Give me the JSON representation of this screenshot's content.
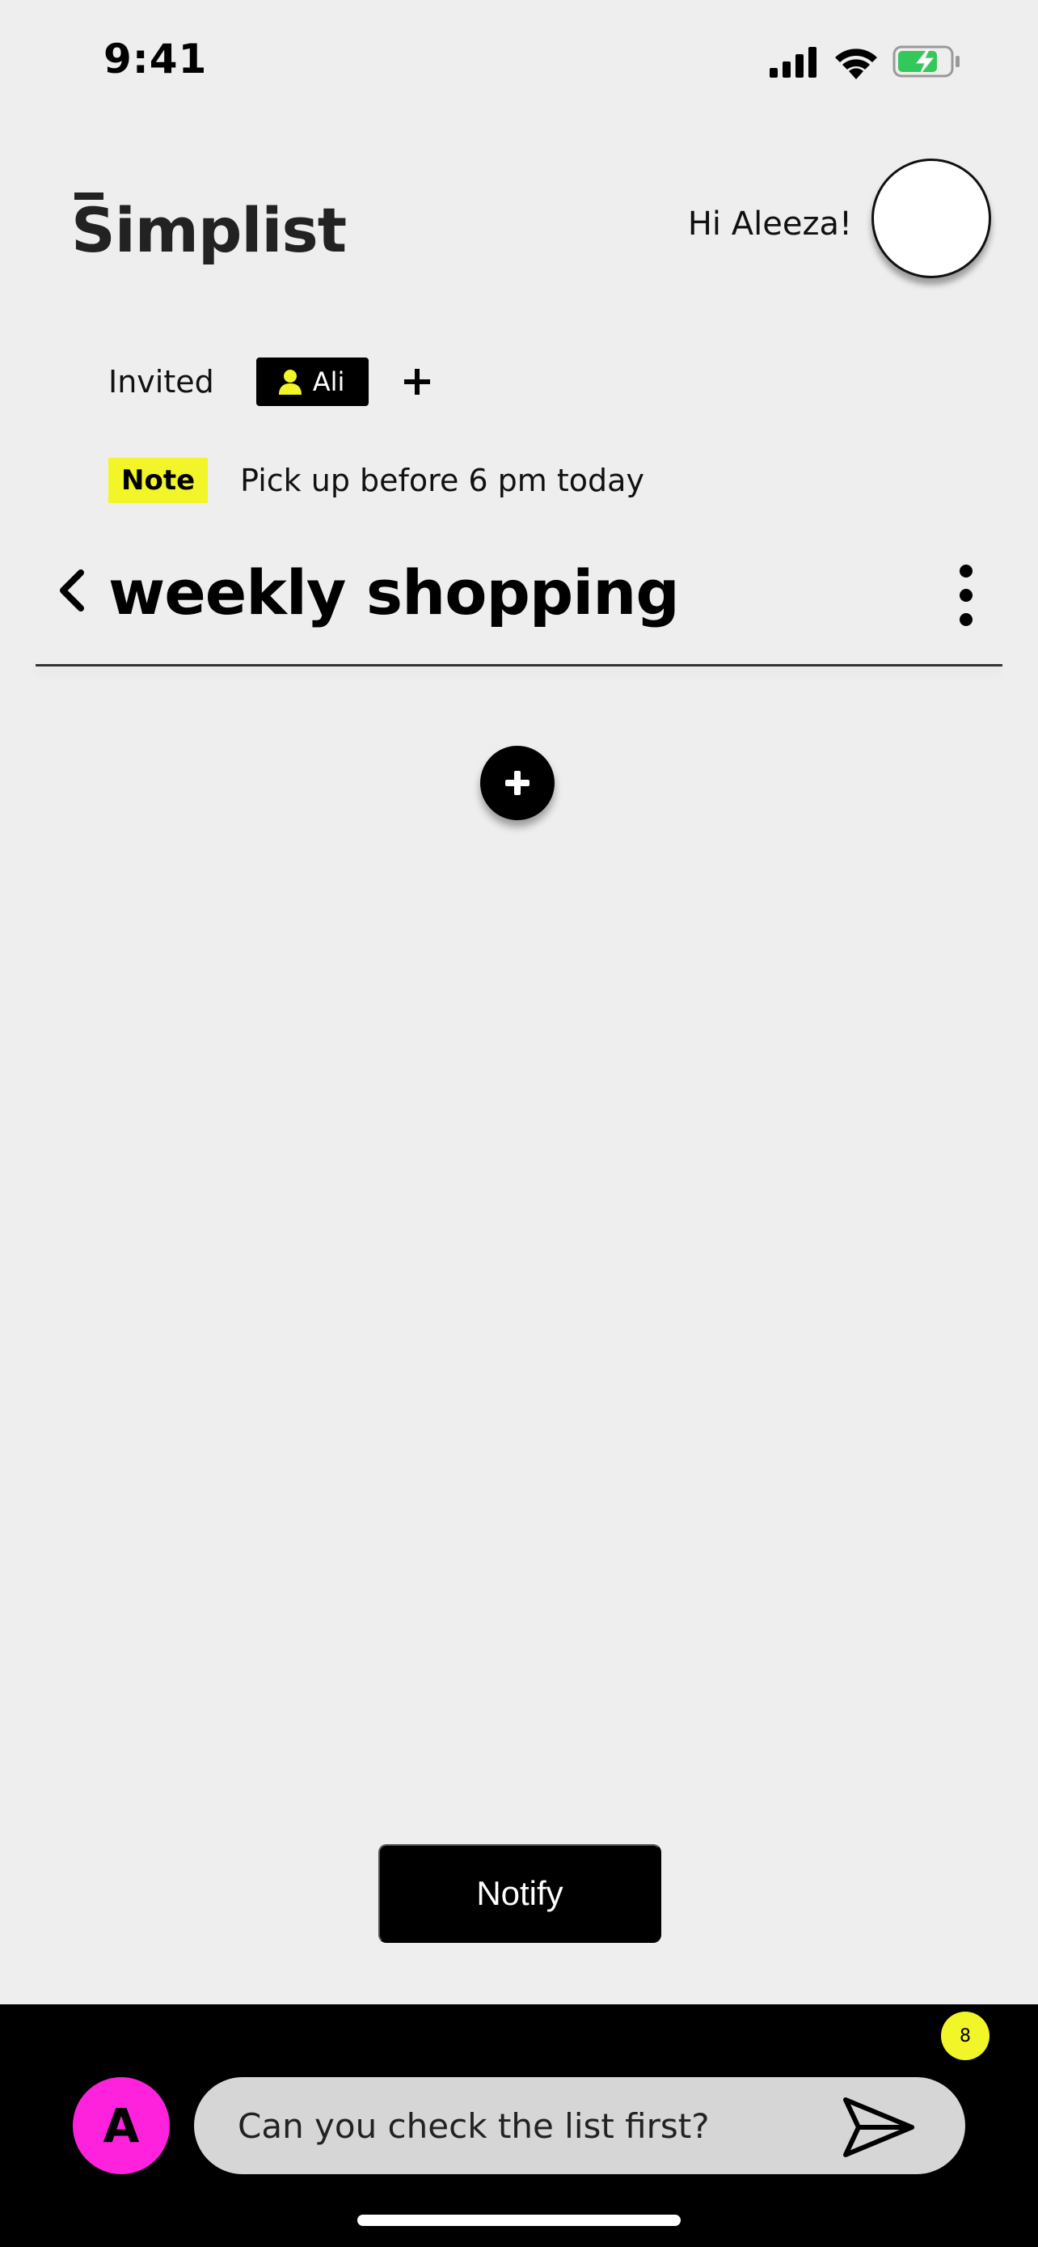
{
  "status_bar": {
    "time": "9:41",
    "icons": [
      "signal-icon",
      "wifi-icon",
      "battery-charging-icon"
    ]
  },
  "header": {
    "brand": "Simplist",
    "greeting": "Hi Aleeza!"
  },
  "invited": {
    "label": "Invited",
    "people": [
      "Ali"
    ]
  },
  "note": {
    "badge": "Note",
    "text": "Pick up before 6 pm today"
  },
  "list": {
    "title": "weekly shopping"
  },
  "actions": {
    "notify_label": "Notify"
  },
  "chat": {
    "avatar_initial": "A",
    "message": "Can you check the list first?",
    "unread_count": "8"
  },
  "colors": {
    "background": "#eeeeee",
    "accent_yellow": "#f2f528",
    "avatar_magenta": "#ff22dd",
    "battery_green": "#34c759"
  }
}
